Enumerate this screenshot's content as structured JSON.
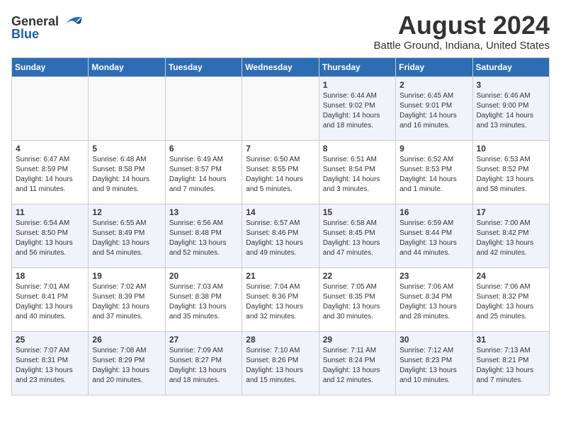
{
  "header": {
    "logo_general": "General",
    "logo_blue": "Blue",
    "title": "August 2024",
    "subtitle": "Battle Ground, Indiana, United States"
  },
  "days_of_week": [
    "Sunday",
    "Monday",
    "Tuesday",
    "Wednesday",
    "Thursday",
    "Friday",
    "Saturday"
  ],
  "weeks": [
    [
      {
        "day": "",
        "content": ""
      },
      {
        "day": "",
        "content": ""
      },
      {
        "day": "",
        "content": ""
      },
      {
        "day": "",
        "content": ""
      },
      {
        "day": "1",
        "content": "Sunrise: 6:44 AM\nSunset: 9:02 PM\nDaylight: 14 hours\nand 18 minutes."
      },
      {
        "day": "2",
        "content": "Sunrise: 6:45 AM\nSunset: 9:01 PM\nDaylight: 14 hours\nand 16 minutes."
      },
      {
        "day": "3",
        "content": "Sunrise: 6:46 AM\nSunset: 9:00 PM\nDaylight: 14 hours\nand 13 minutes."
      }
    ],
    [
      {
        "day": "4",
        "content": "Sunrise: 6:47 AM\nSunset: 8:59 PM\nDaylight: 14 hours\nand 11 minutes."
      },
      {
        "day": "5",
        "content": "Sunrise: 6:48 AM\nSunset: 8:58 PM\nDaylight: 14 hours\nand 9 minutes."
      },
      {
        "day": "6",
        "content": "Sunrise: 6:49 AM\nSunset: 8:57 PM\nDaylight: 14 hours\nand 7 minutes."
      },
      {
        "day": "7",
        "content": "Sunrise: 6:50 AM\nSunset: 8:55 PM\nDaylight: 14 hours\nand 5 minutes."
      },
      {
        "day": "8",
        "content": "Sunrise: 6:51 AM\nSunset: 8:54 PM\nDaylight: 14 hours\nand 3 minutes."
      },
      {
        "day": "9",
        "content": "Sunrise: 6:52 AM\nSunset: 8:53 PM\nDaylight: 14 hours\nand 1 minute."
      },
      {
        "day": "10",
        "content": "Sunrise: 6:53 AM\nSunset: 8:52 PM\nDaylight: 13 hours\nand 58 minutes."
      }
    ],
    [
      {
        "day": "11",
        "content": "Sunrise: 6:54 AM\nSunset: 8:50 PM\nDaylight: 13 hours\nand 56 minutes."
      },
      {
        "day": "12",
        "content": "Sunrise: 6:55 AM\nSunset: 8:49 PM\nDaylight: 13 hours\nand 54 minutes."
      },
      {
        "day": "13",
        "content": "Sunrise: 6:56 AM\nSunset: 8:48 PM\nDaylight: 13 hours\nand 52 minutes."
      },
      {
        "day": "14",
        "content": "Sunrise: 6:57 AM\nSunset: 8:46 PM\nDaylight: 13 hours\nand 49 minutes."
      },
      {
        "day": "15",
        "content": "Sunrise: 6:58 AM\nSunset: 8:45 PM\nDaylight: 13 hours\nand 47 minutes."
      },
      {
        "day": "16",
        "content": "Sunrise: 6:59 AM\nSunset: 8:44 PM\nDaylight: 13 hours\nand 44 minutes."
      },
      {
        "day": "17",
        "content": "Sunrise: 7:00 AM\nSunset: 8:42 PM\nDaylight: 13 hours\nand 42 minutes."
      }
    ],
    [
      {
        "day": "18",
        "content": "Sunrise: 7:01 AM\nSunset: 8:41 PM\nDaylight: 13 hours\nand 40 minutes."
      },
      {
        "day": "19",
        "content": "Sunrise: 7:02 AM\nSunset: 8:39 PM\nDaylight: 13 hours\nand 37 minutes."
      },
      {
        "day": "20",
        "content": "Sunrise: 7:03 AM\nSunset: 8:38 PM\nDaylight: 13 hours\nand 35 minutes."
      },
      {
        "day": "21",
        "content": "Sunrise: 7:04 AM\nSunset: 8:36 PM\nDaylight: 13 hours\nand 32 minutes."
      },
      {
        "day": "22",
        "content": "Sunrise: 7:05 AM\nSunset: 8:35 PM\nDaylight: 13 hours\nand 30 minutes."
      },
      {
        "day": "23",
        "content": "Sunrise: 7:06 AM\nSunset: 8:34 PM\nDaylight: 13 hours\nand 28 minutes."
      },
      {
        "day": "24",
        "content": "Sunrise: 7:06 AM\nSunset: 8:32 PM\nDaylight: 13 hours\nand 25 minutes."
      }
    ],
    [
      {
        "day": "25",
        "content": "Sunrise: 7:07 AM\nSunset: 8:31 PM\nDaylight: 13 hours\nand 23 minutes."
      },
      {
        "day": "26",
        "content": "Sunrise: 7:08 AM\nSunset: 8:29 PM\nDaylight: 13 hours\nand 20 minutes."
      },
      {
        "day": "27",
        "content": "Sunrise: 7:09 AM\nSunset: 8:27 PM\nDaylight: 13 hours\nand 18 minutes."
      },
      {
        "day": "28",
        "content": "Sunrise: 7:10 AM\nSunset: 8:26 PM\nDaylight: 13 hours\nand 15 minutes."
      },
      {
        "day": "29",
        "content": "Sunrise: 7:11 AM\nSunset: 8:24 PM\nDaylight: 13 hours\nand 12 minutes."
      },
      {
        "day": "30",
        "content": "Sunrise: 7:12 AM\nSunset: 8:23 PM\nDaylight: 13 hours\nand 10 minutes."
      },
      {
        "day": "31",
        "content": "Sunrise: 7:13 AM\nSunset: 8:21 PM\nDaylight: 13 hours\nand 7 minutes."
      }
    ]
  ]
}
